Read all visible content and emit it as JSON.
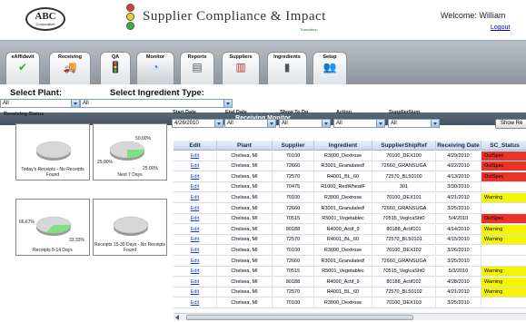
{
  "header": {
    "logo_text": "ABC",
    "logo_sub": "Corporation",
    "title": "Supplier Compliance & Impact",
    "sub_brand": "Translation",
    "welcome": "Welcome: William",
    "logout": "Logout"
  },
  "nav": {
    "tabs": [
      {
        "label": "eAffidavit",
        "icon": "✔"
      },
      {
        "label": "Receiving",
        "icon": "🚚"
      },
      {
        "label": "QA",
        "icon": "🚦"
      },
      {
        "label": "Monitor",
        "icon": "◔"
      },
      {
        "label": "Reports",
        "icon": "▤"
      },
      {
        "label": "Suppliers",
        "icon": "▥"
      },
      {
        "label": "Ingredients",
        "icon": "▮"
      },
      {
        "label": "Setup",
        "icon": "👥"
      }
    ],
    "active_tab": "Monitor",
    "bar_title": "Receiving Monitor"
  },
  "filters": {
    "plant_label": "Select Plant:",
    "plant_value": "All",
    "ingredient_type_label": "Select Ingredient Type:",
    "ingredient_type_value": "All",
    "receiving_status": "Receiving Status",
    "start_date_label": "Start Date",
    "start_date_value": "4/26/2010",
    "end_date_label": "End Date",
    "end_date_value": "All",
    "show_todo_label": "Show To Do",
    "show_todo_value": "All",
    "action_label": "Action",
    "action_value": "All",
    "supplier_num_label": "SupplierNum",
    "supplier_num_value": "All",
    "show_button": "Show Re"
  },
  "pies": [
    {
      "caption": "Today's Receipts - No Receipts Found",
      "labels": []
    },
    {
      "caption": "Next 7 Days",
      "labels": [
        "50.00%",
        "25.00%",
        "25.00%"
      ]
    },
    {
      "caption": "Receipts 8-14 Days",
      "labels": [
        "66.67%",
        "33.33%"
      ]
    },
    {
      "caption": "Receipts 15-30 Days - No Receipts Found",
      "labels": []
    }
  ],
  "grid": {
    "columns": [
      "Edit",
      "Plant",
      "Supplier",
      "Ingredient",
      "SupplierShipRef",
      "Receiving Date",
      "SC_Status"
    ],
    "rows": [
      [
        "Edit",
        "Chelsea, MI",
        "70100",
        "R3000_Dextrose",
        "70100_DEX100",
        "4/29/2010",
        "OutSpec"
      ],
      [
        "Edit",
        "Chelsea, MI",
        "72660",
        "R3001_Granulated!",
        "72660_GRANSUGA",
        "4/22/2010",
        "OutSpec"
      ],
      [
        "Edit",
        "Chelsea, MI",
        "72570",
        "R4001_BL_60",
        "72570_BL50100",
        "4/13/2010",
        "OutSpec"
      ],
      [
        "Edit",
        "Chelsea, MI",
        "70475",
        "R1000_RedWheatF",
        "301",
        "3/30/2010",
        ""
      ],
      [
        "Edit",
        "Chelsea, MI",
        "70100",
        "R3000_Dextrose",
        "70100_DEX101",
        "4/21/2010",
        "Warning"
      ],
      [
        "Edit",
        "Chelsea, MI",
        "72660",
        "R3001_Granulated!",
        "72660_GRANSUGA",
        "3/25/2010",
        ""
      ],
      [
        "Edit",
        "Chelsea, MI",
        "70515",
        "R5001_Vegetablec",
        "70515_VeglcaSht0",
        "5/4/2010",
        "OutSpec"
      ],
      [
        "Edit",
        "Chelsea, MI",
        "80188",
        "R4000_Actif_9",
        "80188_Actif101",
        "4/14/2010",
        "Warning"
      ],
      [
        "Edit",
        "Chelsea, MI",
        "72570",
        "R4001_BL_60",
        "72570_BL50101",
        "4/15/2010",
        "Warning"
      ],
      [
        "Edit",
        "Chelsea, MI",
        "70100",
        "R3000_Dextrose",
        "70100_DEX102",
        "3/26/2010",
        ""
      ],
      [
        "Edit",
        "Chelsea, MI",
        "72660",
        "R3001_Granulated!",
        "72660_GRANSUGA",
        "3/25/2010",
        ""
      ],
      [
        "Edit",
        "Chelsea, MI",
        "70515",
        "R5001_Vegetablec",
        "70515_VeglcaSht0",
        "5/3/2010",
        "Warning"
      ],
      [
        "Edit",
        "Chelsea, MI",
        "80188",
        "R4000_Actif_9",
        "80188_Actif102",
        "4/28/2010",
        "Warning"
      ],
      [
        "Edit",
        "Chelsea, MI",
        "72570",
        "R4001_BL_60",
        "72570_BL50102",
        "4/21/2010",
        "Warning"
      ],
      [
        "Edit",
        "Chelsea, MI",
        "70100",
        "R3000_Dextrose",
        "70100_DEX103",
        "3/25/2010",
        ""
      ]
    ]
  },
  "colors": {
    "outspec": "#e8342a",
    "warning": "#f5f500",
    "pie_gray": "#d7d7d7",
    "pie_green": "#7fe07f",
    "nav_bar": "#4d5b6b",
    "link": "#1a3bd6"
  }
}
